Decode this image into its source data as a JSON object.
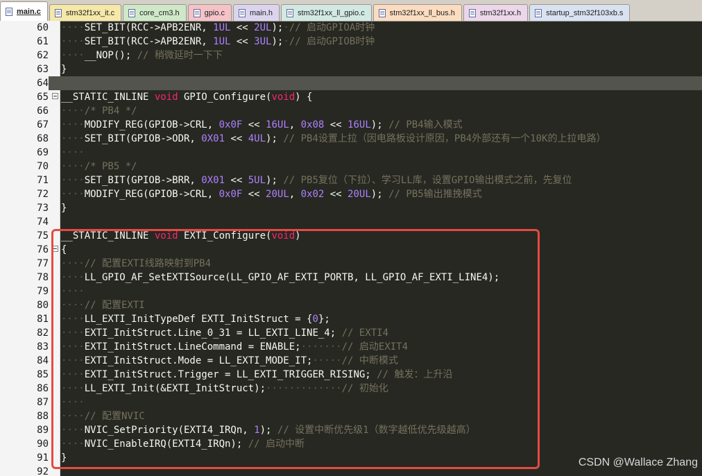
{
  "tabs": [
    {
      "label": "main.c",
      "active": true,
      "color": "#ffffff"
    },
    {
      "label": "stm32f1xx_it.c",
      "active": false,
      "color": "#f5e8a8"
    },
    {
      "label": "core_cm3.h",
      "active": false,
      "color": "#cfe9c8"
    },
    {
      "label": "gpio.c",
      "active": false,
      "color": "#f5c2c8"
    },
    {
      "label": "main.h",
      "active": false,
      "color": "#dcd4ef"
    },
    {
      "label": "stm32f1xx_ll_gpio.c",
      "active": false,
      "color": "#d2e9e3"
    },
    {
      "label": "stm32f1xx_ll_bus.h",
      "active": false,
      "color": "#fbdcc0"
    },
    {
      "label": "stm32f1xx.h",
      "active": false,
      "color": "#ecd6ea"
    },
    {
      "label": "startup_stm32f103xb.s",
      "active": false,
      "color": "#d9e2f1"
    }
  ],
  "editor": {
    "current_line": 64,
    "lines": [
      {
        "n": "60",
        "tokens": [
          [
            "ws",
            "····"
          ],
          [
            "",
            "SET_BIT(RCC->APB2ENR, "
          ],
          [
            "nm",
            "1UL"
          ],
          [
            "",
            " << "
          ],
          [
            "nm",
            "2UL"
          ],
          [
            "",
            ");"
          ],
          [
            "ws",
            "·"
          ],
          [
            "cm",
            "// 启动GPIOA时钟"
          ]
        ]
      },
      {
        "n": "61",
        "tokens": [
          [
            "ws",
            "····"
          ],
          [
            "",
            "SET_BIT(RCC->APB2ENR, "
          ],
          [
            "nm",
            "1UL"
          ],
          [
            "",
            " << "
          ],
          [
            "nm",
            "3UL"
          ],
          [
            "",
            ");"
          ],
          [
            "ws",
            "·"
          ],
          [
            "cm",
            "// 启动GPIOB时钟"
          ]
        ]
      },
      {
        "n": "62",
        "tokens": [
          [
            "ws",
            "····"
          ],
          [
            "",
            "__NOP(); "
          ],
          [
            "cm",
            "// 稍微延时一下下"
          ]
        ]
      },
      {
        "n": "63",
        "tokens": [
          [
            "",
            "}"
          ]
        ]
      },
      {
        "n": "64",
        "tokens": []
      },
      {
        "n": "65",
        "fold": true,
        "tokens": [
          [
            "",
            "__STATIC_INLINE "
          ],
          [
            "kw",
            "void"
          ],
          [
            "",
            " GPIO_Configure("
          ],
          [
            "kw",
            "void"
          ],
          [
            "",
            ") {"
          ]
        ]
      },
      {
        "n": "66",
        "tokens": [
          [
            "ws",
            "····"
          ],
          [
            "cm",
            "/* PB4 */"
          ]
        ]
      },
      {
        "n": "67",
        "tokens": [
          [
            "ws",
            "····"
          ],
          [
            "",
            "MODIFY_REG(GPIOB->CRL, "
          ],
          [
            "nm",
            "0x0F"
          ],
          [
            "",
            " << "
          ],
          [
            "nm",
            "16UL"
          ],
          [
            "",
            ", "
          ],
          [
            "nm",
            "0x08"
          ],
          [
            "",
            " << "
          ],
          [
            "nm",
            "16UL"
          ],
          [
            "",
            "); "
          ],
          [
            "cm",
            "// PB4输入模式"
          ]
        ]
      },
      {
        "n": "68",
        "tokens": [
          [
            "ws",
            "····"
          ],
          [
            "",
            "SET_BIT(GPIOB->ODR, "
          ],
          [
            "nm",
            "0X01"
          ],
          [
            "",
            " << "
          ],
          [
            "nm",
            "4UL"
          ],
          [
            "",
            "); "
          ],
          [
            "cm",
            "// PB4设置上拉（因电路板设计原因，PB4外部还有一个10K的上拉电路）"
          ]
        ]
      },
      {
        "n": "69",
        "tokens": [
          [
            "ws",
            "····"
          ]
        ]
      },
      {
        "n": "70",
        "tokens": [
          [
            "ws",
            "····"
          ],
          [
            "cm",
            "/* PB5 */"
          ]
        ]
      },
      {
        "n": "71",
        "tokens": [
          [
            "ws",
            "····"
          ],
          [
            "",
            "SET_BIT(GPIOB->BRR, "
          ],
          [
            "nm",
            "0X01"
          ],
          [
            "",
            " << "
          ],
          [
            "nm",
            "5UL"
          ],
          [
            "",
            "); "
          ],
          [
            "cm",
            "// PB5复位（下拉）、学习LL库，设置GPIO输出模式之前，先复位"
          ]
        ]
      },
      {
        "n": "72",
        "tokens": [
          [
            "ws",
            "····"
          ],
          [
            "",
            "MODIFY_REG(GPIOB->CRL, "
          ],
          [
            "nm",
            "0x0F"
          ],
          [
            "",
            " << "
          ],
          [
            "nm",
            "20UL"
          ],
          [
            "",
            ", "
          ],
          [
            "nm",
            "0x02"
          ],
          [
            "",
            " << "
          ],
          [
            "nm",
            "20UL"
          ],
          [
            "",
            "); "
          ],
          [
            "cm",
            "// PB5输出推挽模式"
          ]
        ]
      },
      {
        "n": "73",
        "tokens": [
          [
            "",
            "}"
          ]
        ]
      },
      {
        "n": "74",
        "tokens": []
      },
      {
        "n": "75",
        "tokens": [
          [
            "",
            "__STATIC_INLINE "
          ],
          [
            "kw",
            "void"
          ],
          [
            "",
            " EXTI_Configure("
          ],
          [
            "kw",
            "void"
          ],
          [
            "",
            ")"
          ]
        ]
      },
      {
        "n": "76",
        "fold": true,
        "tokens": [
          [
            "",
            "{"
          ]
        ]
      },
      {
        "n": "77",
        "tokens": [
          [
            "ws",
            "····"
          ],
          [
            "cm",
            "// 配置EXTI线路映射到PB4"
          ]
        ]
      },
      {
        "n": "78",
        "tokens": [
          [
            "ws",
            "····"
          ],
          [
            "",
            "LL_GPIO_AF_SetEXTISource(LL_GPIO_AF_EXTI_PORTB, LL_GPIO_AF_EXTI_LINE4);"
          ]
        ]
      },
      {
        "n": "79",
        "tokens": [
          [
            "ws",
            "····"
          ]
        ]
      },
      {
        "n": "80",
        "tokens": [
          [
            "ws",
            "····"
          ],
          [
            "cm",
            "// 配置EXTI"
          ]
        ]
      },
      {
        "n": "81",
        "tokens": [
          [
            "ws",
            "····"
          ],
          [
            "",
            "LL_EXTI_InitTypeDef EXTI_InitStruct = {"
          ],
          [
            "nm",
            "0"
          ],
          [
            "",
            "};"
          ]
        ]
      },
      {
        "n": "82",
        "tokens": [
          [
            "ws",
            "····"
          ],
          [
            "",
            "EXTI_InitStruct.Line_0_31 = LL_EXTI_LINE_4; "
          ],
          [
            "cm",
            "// EXTI4"
          ]
        ]
      },
      {
        "n": "83",
        "tokens": [
          [
            "ws",
            "····"
          ],
          [
            "",
            "EXTI_InitStruct.LineCommand = ENABLE;"
          ],
          [
            "ws",
            "·······"
          ],
          [
            "cm",
            "// 启动EXIT4"
          ]
        ]
      },
      {
        "n": "84",
        "tokens": [
          [
            "ws",
            "····"
          ],
          [
            "",
            "EXTI_InitStruct.Mode = LL_EXTI_MODE_IT;"
          ],
          [
            "ws",
            "·····"
          ],
          [
            "cm",
            "// 中断模式"
          ]
        ]
      },
      {
        "n": "85",
        "tokens": [
          [
            "ws",
            "····"
          ],
          [
            "",
            "EXTI_InitStruct.Trigger = LL_EXTI_TRIGGER_RISING; "
          ],
          [
            "cm",
            "// 触发：上升沿"
          ]
        ]
      },
      {
        "n": "86",
        "tokens": [
          [
            "ws",
            "····"
          ],
          [
            "",
            "LL_EXTI_Init(&EXTI_InitStruct);"
          ],
          [
            "ws",
            "·············"
          ],
          [
            "cm",
            "// 初始化"
          ]
        ]
      },
      {
        "n": "87",
        "tokens": [
          [
            "ws",
            "····"
          ]
        ]
      },
      {
        "n": "88",
        "tokens": [
          [
            "ws",
            "····"
          ],
          [
            "cm",
            "// 配置NVIC"
          ]
        ]
      },
      {
        "n": "89",
        "tokens": [
          [
            "ws",
            "····"
          ],
          [
            "",
            "NVIC_SetPriority(EXTI4_IRQn, "
          ],
          [
            "nm",
            "1"
          ],
          [
            "",
            "); "
          ],
          [
            "cm",
            "// 设置中断优先级1（数字越低优先级越高）"
          ]
        ]
      },
      {
        "n": "90",
        "tokens": [
          [
            "ws",
            "····"
          ],
          [
            "",
            "NVIC_EnableIRQ(EXTI4_IRQn); "
          ],
          [
            "cm",
            "// 启动中断"
          ]
        ]
      },
      {
        "n": "91",
        "tokens": [
          [
            "",
            "}"
          ]
        ]
      },
      {
        "n": "92",
        "tokens": []
      }
    ]
  },
  "watermark": "CSDN @Wallace Zhang"
}
